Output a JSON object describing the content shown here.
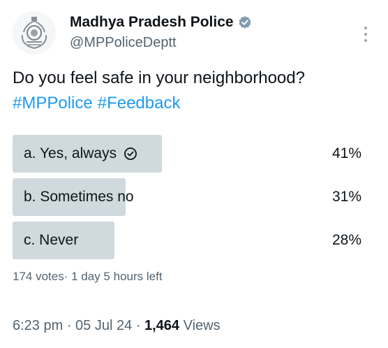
{
  "account": {
    "display_name": "Madhya Pradesh Police",
    "handle": "@MPPoliceDeptt",
    "verified": true
  },
  "tweet": {
    "question": "Do you feel safe in your neighborhood?",
    "hashtags": [
      "#MPPolice",
      "#Feedback"
    ]
  },
  "poll": {
    "options": [
      {
        "label": "a. Yes, always",
        "percent": "41%",
        "value": 41,
        "selected": true
      },
      {
        "label": "b. Sometimes no",
        "percent": "31%",
        "value": 31,
        "selected": false
      },
      {
        "label": "c. Never",
        "percent": "28%",
        "value": 28,
        "selected": false
      }
    ],
    "votes": "174 votes",
    "time_left": "1 day 5 hours left"
  },
  "footer": {
    "time": "6:23 pm",
    "date": "05 Jul 24",
    "views_count": "1,464",
    "views_label": "Views"
  },
  "colors": {
    "link": "#1d9bf0",
    "bar": "#cfd9de",
    "secondary_text": "#536471"
  },
  "icons": {
    "avatar": "police-emblem-icon",
    "verified": "verified-badge-icon",
    "more": "more-vertical-icon",
    "selected": "check-circle-icon"
  }
}
